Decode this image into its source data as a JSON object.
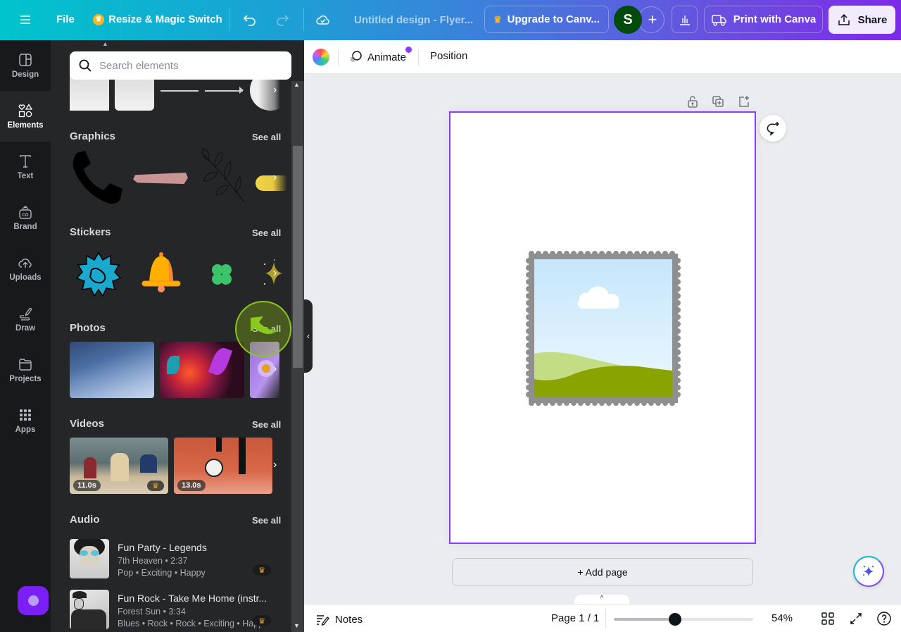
{
  "topbar": {
    "menu_icon": "hamburger-icon",
    "file_label": "File",
    "resize_label": "Resize & Magic Switch",
    "undo_icon": "undo-icon",
    "redo_icon": "redo-icon",
    "save_status_icon": "cloud-check-icon",
    "design_title": "Untitled design - Flyer...",
    "upgrade_label": "Upgrade to Canv...",
    "avatar_initial": "S",
    "add_collaborator": "+",
    "print_label": "Print with Canva",
    "share_label": "Share"
  },
  "sidebar": {
    "items": [
      {
        "label": "Design",
        "icon": "layout-icon",
        "active": false
      },
      {
        "label": "Elements",
        "icon": "shapes-icon",
        "active": true
      },
      {
        "label": "Text",
        "icon": "text-icon",
        "active": false
      },
      {
        "label": "Brand",
        "icon": "brand-icon",
        "active": false
      },
      {
        "label": "Uploads",
        "icon": "cloud-upload-icon",
        "active": false
      },
      {
        "label": "Draw",
        "icon": "pen-icon",
        "active": false
      },
      {
        "label": "Projects",
        "icon": "folder-icon",
        "active": false
      },
      {
        "label": "Apps",
        "icon": "grid-icon",
        "active": false
      }
    ]
  },
  "panel": {
    "search_placeholder": "Search elements",
    "see_all": "See all",
    "sections": {
      "graphics": "Graphics",
      "stickers": "Stickers",
      "photos": "Photos",
      "videos": "Videos",
      "audio": "Audio"
    },
    "videos": [
      {
        "duration": "11.0s",
        "premium": true
      },
      {
        "duration": "13.0s",
        "premium": false
      }
    ],
    "audio": [
      {
        "title": "Fun Party - Legends",
        "artist_duration": "7th Heaven • 2:37",
        "tags": "Pop • Exciting • Happy",
        "premium": true
      },
      {
        "title": "Fun Rock - Take Me Home (instr...",
        "artist_duration": "Forest Sun • 3:34",
        "tags": "Blues • Rock • Rock • Exciting • Happ...",
        "premium": true
      }
    ]
  },
  "context_bar": {
    "animate_label": "Animate",
    "position_label": "Position"
  },
  "canvas": {
    "add_page_label": "+ Add page"
  },
  "footer": {
    "notes_label": "Notes",
    "page_indicator": "Page 1 / 1",
    "zoom_percent": "54%",
    "zoom_slider_fraction": 0.44
  },
  "colors": {
    "accent": "#8b3dff",
    "sidebar_bg": "#18191b",
    "panel_bg": "#252627"
  }
}
